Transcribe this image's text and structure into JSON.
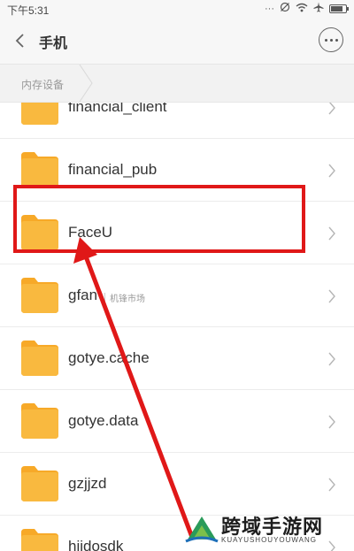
{
  "status_bar": {
    "time": "下午5:31",
    "icons": [
      "dots-icon",
      "mute-icon",
      "wifi-icon",
      "airplane-icon",
      "battery-icon"
    ]
  },
  "top_bar": {
    "title": "手机",
    "back_icon": "chevron-left-icon",
    "more_icon": "more-dots-icon"
  },
  "breadcrumb": {
    "label": "内存设备"
  },
  "files": [
    {
      "name": "financial_client",
      "tag": ""
    },
    {
      "name": "financial_pub",
      "tag": ""
    },
    {
      "name": "FaceU",
      "tag": ""
    },
    {
      "name": "gfan",
      "tag": "机锋市场"
    },
    {
      "name": "gotye.cache",
      "tag": ""
    },
    {
      "name": "gotye.data",
      "tag": ""
    },
    {
      "name": "gzjjzd",
      "tag": ""
    },
    {
      "name": "hiidosdk",
      "tag": ""
    }
  ],
  "annotation": {
    "highlight_color": "#e01818",
    "highlighted_item": "FaceU"
  },
  "watermark": {
    "title": "跨域手游网",
    "subtitle": "KUAYUSHOUYOUWANG"
  },
  "colors": {
    "folder": "#f9b93f",
    "folder_tab": "#f7a928",
    "accent_red": "#e01818"
  }
}
